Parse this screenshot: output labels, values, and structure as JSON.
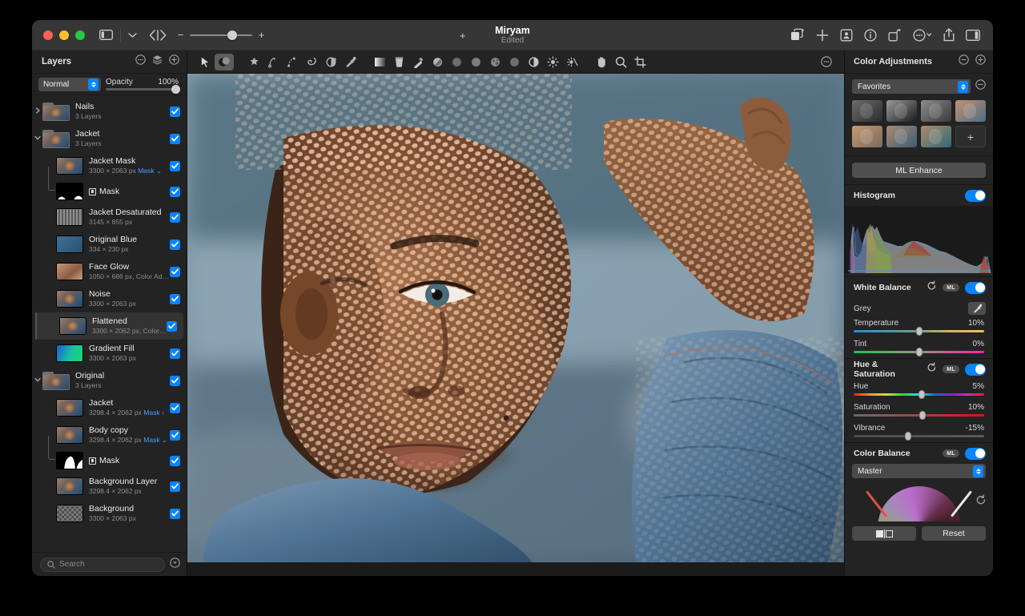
{
  "titlebar": {
    "document_title": "Miryam",
    "document_status": "Edited",
    "zoom_minus": "−",
    "zoom_plus": "+",
    "plus_label": "+",
    "right_icons": [
      {
        "name": "duplicate-icon"
      },
      {
        "name": "add-icon"
      },
      {
        "name": "persona-icon"
      },
      {
        "name": "info-icon"
      },
      {
        "name": "rotate-icon"
      },
      {
        "name": "more-options-icon"
      },
      {
        "name": "share-icon"
      },
      {
        "name": "inspector-icon"
      }
    ]
  },
  "layers_panel": {
    "title": "Layers",
    "blend_mode": "Normal",
    "opacity_label": "Opacity",
    "opacity_value": "100%",
    "search_placeholder": "Search",
    "items": [
      {
        "name": "Nails",
        "meta": "3 Layers",
        "type": "group",
        "indent": 0,
        "expanded": false,
        "checked": true,
        "selected": false,
        "mask_link": ""
      },
      {
        "name": "Jacket",
        "meta": "3 Layers",
        "type": "group",
        "indent": 0,
        "expanded": true,
        "checked": true,
        "selected": false,
        "mask_link": ""
      },
      {
        "name": "Jacket Mask",
        "meta": "3300 × 2063 px",
        "type": "image",
        "indent": 1,
        "checked": true,
        "selected": false,
        "mask_link": "Mask ⌄"
      },
      {
        "name": "Mask",
        "meta": "",
        "type": "mask",
        "indent": 2,
        "checked": true,
        "selected": false,
        "mask_link": ""
      },
      {
        "name": "Jacket Desaturated",
        "meta": "3145 × 855 px",
        "type": "image",
        "indent": 1,
        "checked": true,
        "selected": false,
        "mask_link": ""
      },
      {
        "name": "Original Blue",
        "meta": "334 × 230 px",
        "type": "image",
        "indent": 1,
        "checked": true,
        "selected": false,
        "mask_link": ""
      },
      {
        "name": "Face Glow",
        "meta": "1050 × 686 px, Color Adjustme…",
        "type": "image",
        "indent": 1,
        "checked": true,
        "selected": false,
        "mask_link": ""
      },
      {
        "name": "Noise",
        "meta": "3300 × 2063 px",
        "type": "image",
        "indent": 1,
        "checked": true,
        "selected": false,
        "mask_link": ""
      },
      {
        "name": "Flattened",
        "meta": "3300 × 2062 px, Color Adjust…",
        "type": "image",
        "indent": 1,
        "checked": true,
        "selected": true,
        "mask_link": ""
      },
      {
        "name": "Gradient Fill",
        "meta": "3300 × 2063 px",
        "type": "gradient",
        "indent": 1,
        "checked": true,
        "selected": false,
        "mask_link": ""
      },
      {
        "name": "Original",
        "meta": "3 Layers",
        "type": "group",
        "indent": 0,
        "expanded": true,
        "checked": true,
        "selected": false,
        "mask_link": ""
      },
      {
        "name": "Jacket",
        "meta": "3298.4 × 2062 px",
        "type": "image",
        "indent": 1,
        "checked": true,
        "selected": false,
        "mask_link": "Mask ›"
      },
      {
        "name": "Body copy",
        "meta": "3298.4 × 2062 px",
        "type": "image",
        "indent": 1,
        "checked": true,
        "selected": false,
        "mask_link": "Mask ⌄"
      },
      {
        "name": "Mask",
        "meta": "",
        "type": "mask",
        "indent": 2,
        "checked": true,
        "selected": false,
        "mask_link": ""
      },
      {
        "name": "Background Layer",
        "meta": "3298.4 × 2062 px",
        "type": "image",
        "indent": 1,
        "checked": true,
        "selected": false,
        "mask_link": ""
      },
      {
        "name": "Background",
        "meta": "3300 × 2063 px",
        "type": "image",
        "indent": 1,
        "checked": true,
        "selected": false,
        "mask_link": ""
      }
    ],
    "header_icons": [
      {
        "name": "more-options-icon"
      },
      {
        "name": "layers-stack-icon"
      },
      {
        "name": "add-layer-icon"
      }
    ]
  },
  "toolbar": {
    "tools": [
      {
        "name": "move-tool",
        "active": false
      },
      {
        "name": "selection-brush-tool",
        "active": true
      },
      {
        "name": "magic-wand-tool",
        "active": false
      },
      {
        "name": "pen-tool",
        "active": false
      },
      {
        "name": "node-tool",
        "active": false
      },
      {
        "name": "smudge-tool",
        "active": false
      },
      {
        "name": "clone-brush-tool",
        "active": false
      },
      {
        "name": "color-picker-tool",
        "active": false
      },
      {
        "name": "gradient-tool",
        "active": false
      },
      {
        "name": "paint-bucket-tool",
        "active": false
      },
      {
        "name": "paint-brush-tool",
        "active": false
      },
      {
        "name": "erase-brush-tool",
        "active": false
      },
      {
        "name": "dodge-brush-tool",
        "active": false
      },
      {
        "name": "blur-brush-tool",
        "active": false
      },
      {
        "name": "sponge-brush-tool",
        "active": false
      },
      {
        "name": "burn-brush-tool",
        "active": false
      },
      {
        "name": "contrast-tool",
        "active": false
      },
      {
        "name": "lighten-tool",
        "active": false
      },
      {
        "name": "dehaze-tool",
        "active": false
      },
      {
        "name": "hand-tool",
        "active": false
      },
      {
        "name": "zoom-tool",
        "active": false
      },
      {
        "name": "crop-tool",
        "active": false
      },
      {
        "name": "more-tools-icon",
        "active": false
      }
    ]
  },
  "right_panel": {
    "title": "Color Adjustments",
    "header_icons": [
      {
        "name": "collapse-icon"
      },
      {
        "name": "expand-icon"
      }
    ],
    "presets": {
      "category": "Favorites",
      "add_label": "+",
      "thumbs": [
        {
          "name": "preset-thumb-1",
          "tone": "mono-dark"
        },
        {
          "name": "preset-thumb-2",
          "tone": "mono-contrast"
        },
        {
          "name": "preset-thumb-3",
          "tone": "mono-soft"
        },
        {
          "name": "preset-thumb-4",
          "tone": "color-warm"
        },
        {
          "name": "preset-thumb-5",
          "tone": "color-sepia"
        },
        {
          "name": "preset-thumb-6",
          "tone": "color-cool"
        },
        {
          "name": "preset-thumb-7",
          "tone": "color-teal"
        }
      ]
    },
    "ml_enhance_label": "ML Enhance",
    "histogram": {
      "label": "Histogram",
      "enabled": true
    },
    "white_balance": {
      "title": "White Balance",
      "ml_label": "ML",
      "enabled": true,
      "grey_label": "Grey",
      "sliders": [
        {
          "label": "Temperature",
          "value": "10%",
          "pos": 50
        },
        {
          "label": "Tint",
          "value": "0%",
          "pos": 50
        }
      ]
    },
    "hue_saturation": {
      "title": "Hue & Saturation",
      "ml_label": "ML",
      "enabled": true,
      "sliders": [
        {
          "label": "Hue",
          "value": "5%",
          "pos": 52
        },
        {
          "label": "Saturation",
          "value": "10%",
          "pos": 53
        },
        {
          "label": "Vibrance",
          "value": "-15%",
          "pos": 42
        }
      ]
    },
    "color_balance": {
      "title": "Color Balance",
      "ml_label": "ML",
      "enabled": true,
      "range": "Master",
      "reset_label": "Reset"
    }
  }
}
